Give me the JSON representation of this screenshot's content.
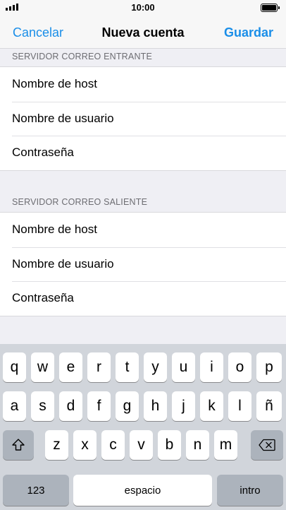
{
  "status": {
    "time": "10:00"
  },
  "nav": {
    "cancel": "Cancelar",
    "title": "Nueva cuenta",
    "save": "Guardar"
  },
  "incoming": {
    "header": "SERVIDOR CORREO ENTRANTE",
    "rows": [
      "Nombre de host",
      "Nombre de usuario",
      "Contraseña"
    ]
  },
  "outgoing": {
    "header": "SERVIDOR CORREO SALIENTE",
    "rows": [
      "Nombre de host",
      "Nombre de usuario",
      "Contraseña"
    ]
  },
  "keyboard": {
    "row1": [
      "q",
      "w",
      "e",
      "r",
      "t",
      "y",
      "u",
      "i",
      "o",
      "p"
    ],
    "row2": [
      "a",
      "s",
      "d",
      "f",
      "g",
      "h",
      "j",
      "k",
      "l",
      "ñ"
    ],
    "row3": [
      "z",
      "x",
      "c",
      "v",
      "b",
      "n",
      "m"
    ],
    "numbers": "123",
    "space": "espacio",
    "return": "intro",
    "shift_icon": "shift-icon",
    "delete_icon": "backspace-icon"
  }
}
